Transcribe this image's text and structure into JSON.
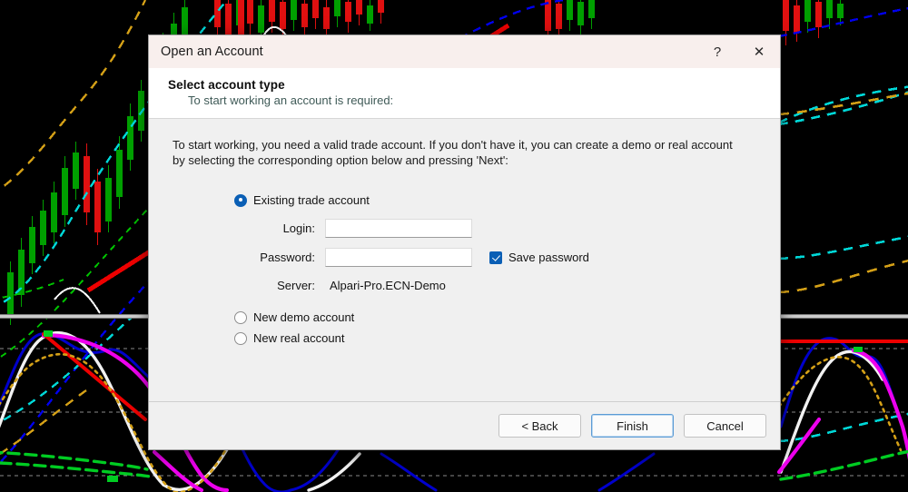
{
  "window": {
    "title": "Open an Account",
    "help_icon": "help-question-icon",
    "help_label": "?",
    "close_icon": "close-x-icon",
    "close_label": "✕"
  },
  "header": {
    "title": "Select account type",
    "subtitle": "To start working an account is required:"
  },
  "body": {
    "intro": "To start working, you need a valid trade account. If you don't have it, you can create a demo or real account by selecting the corresponding option below and pressing 'Next':",
    "options": [
      {
        "id": "existing",
        "label": "Existing trade account",
        "checked": true
      },
      {
        "id": "demo",
        "label": "New demo account",
        "checked": false
      },
      {
        "id": "real",
        "label": "New real account",
        "checked": false
      }
    ],
    "fields": {
      "login_label": "Login:",
      "login_value": "",
      "login_placeholder": "",
      "password_label": "Password:",
      "password_value": "",
      "password_placeholder": "",
      "server_label": "Server:",
      "server_value": "Alpari-Pro.ECN-Demo"
    },
    "save_password": {
      "label": "Save password",
      "checked": true
    }
  },
  "footer": {
    "back_label": "< Back",
    "finish_label": "Finish",
    "cancel_label": "Cancel"
  },
  "colors": {
    "titlebar_bg": "#f8efed",
    "dialog_bg": "#f0f0f0",
    "accent_blue": "#0b5fb5",
    "default_button_border": "#5b9bd5",
    "subtitle_text": "#3f5a57",
    "chart_bg": "#000000"
  },
  "background_chart": {
    "description": "MetaTrader price chart behind dialog",
    "panels": [
      {
        "name": "price-panel",
        "series": [
          {
            "name": "candlesticks",
            "up_color": "#00a000",
            "down_color": "#e01010"
          },
          {
            "name": "upper-band",
            "color": "#00d8d8",
            "style": "dashed"
          },
          {
            "name": "lower-band",
            "color": "#d4a017",
            "style": "dashed"
          },
          {
            "name": "signal-line",
            "color": "#0000ee",
            "style": "dashed"
          },
          {
            "name": "fast-ma",
            "color": "#00c000",
            "style": "dashed"
          },
          {
            "name": "trend-line",
            "color": "#ee0000",
            "style": "solid"
          },
          {
            "name": "white-marker",
            "color": "#ffffff",
            "style": "solid"
          }
        ]
      },
      {
        "name": "oscillator-panel",
        "series": [
          {
            "name": "blue-osc",
            "color": "#0000cc",
            "style": "solid"
          },
          {
            "name": "white-osc",
            "color": "#f2f2f2",
            "style": "solid"
          },
          {
            "name": "magenta-osc",
            "color": "#ee00ee",
            "style": "solid"
          },
          {
            "name": "red-trend",
            "color": "#ee0000",
            "style": "solid"
          },
          {
            "name": "yellow-dotted",
            "color": "#d4a017",
            "style": "dotted"
          },
          {
            "name": "green-dashed",
            "color": "#00cc22",
            "style": "dashed"
          }
        ],
        "gridlines": {
          "color": "#888888",
          "style": "dashed",
          "count": 3
        }
      }
    ]
  }
}
